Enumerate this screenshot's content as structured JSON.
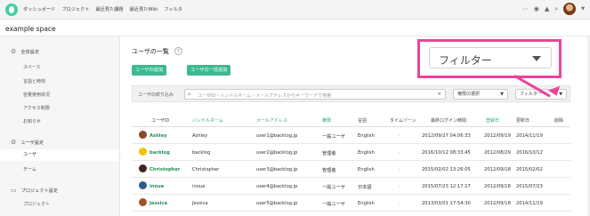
{
  "nav": {
    "items": [
      "ダッシュボード",
      "プロジェクト",
      "最近見た課題",
      "最近見たWiki",
      "フィルタ"
    ],
    "right_icons": [
      "more-icon",
      "watch-icon",
      "bell-icon",
      "search-icon",
      "avatar"
    ]
  },
  "space": {
    "title": "example space"
  },
  "sidebar": {
    "section1": "全体設定",
    "items1": [
      "スペース",
      "言語と時刻",
      "容量使用状況",
      "アクセス制限",
      "お知らせ"
    ],
    "section2": "ユーザ設定",
    "items2": [
      "ユーザ",
      "チーム"
    ],
    "active": "ユーザ",
    "section3": "プロジェクト設定",
    "items3": [
      "プロジェクト"
    ]
  },
  "main": {
    "title": "ユーザの一覧",
    "help": "?",
    "buttons": {
      "add": "ユーザの追加",
      "bulk_add": "ユーザの一括追加"
    },
    "filter": {
      "label": "ユーザの絞り込み",
      "placeholder": "ユーザID・ハンドルネーム・メールアドレスからキーワードで検索",
      "clear": "×",
      "role_select": "権限の選択",
      "filter_select": "フィルター"
    },
    "columns": [
      "ユーザID",
      "ハンドルネーム",
      "メールアドレス",
      "権限",
      "言語",
      "タイムゾーン",
      "最終ログイン時間",
      "登録日",
      "更新日",
      "削除"
    ],
    "rows": [
      {
        "id": "Ashley",
        "handle": "Ashley",
        "email": "user1@backlog.jp",
        "role": "一般ユーザ",
        "lang": "English",
        "tz": "-",
        "last_login": "2012/09/27 04:06:33",
        "registered": "2012/09/19",
        "updated": "2014/11/19",
        "avatar_color": "#8a4b2a"
      },
      {
        "id": "backlog",
        "handle": "backlog",
        "email": "user2@backlog.jp",
        "role": "管理者",
        "lang": "English",
        "tz": "-",
        "last_login": "2016/10/12 08:33:45",
        "registered": "2012/08/29",
        "updated": "2016/10/12",
        "avatar_color": "#f2c200"
      },
      {
        "id": "Christopher",
        "handle": "Christopher",
        "email": "user3@backlog.jp",
        "role": "管理者",
        "lang": "English",
        "tz": "-",
        "last_login": "2015/02/02 13:26:05",
        "registered": "2012/09/18",
        "updated": "2015/02/02",
        "avatar_color": "#3a2a22"
      },
      {
        "id": "inoue",
        "handle": "inoue",
        "email": "user4@backlog.jp",
        "role": "一般ユーザ",
        "lang": "日本語",
        "tz": "-",
        "last_login": "2015/07/23 12:17:17",
        "registered": "2012/09/18",
        "updated": "2015/07/23",
        "avatar_color": "#2e5a8a"
      },
      {
        "id": "Jessica",
        "handle": "Jessica",
        "email": "user5@backlog.jp",
        "role": "一般ユーザ",
        "lang": "English",
        "tz": "-",
        "last_login": "2013/03/01 17:54:30",
        "registered": "2012/09/18",
        "updated": "2014/11/19",
        "avatar_color": "#a0522d"
      }
    ]
  },
  "callout": {
    "text": "フィルター"
  },
  "colors": {
    "accent": "#3db98e",
    "link": "#2aa67a",
    "highlight": "#e8459a"
  }
}
